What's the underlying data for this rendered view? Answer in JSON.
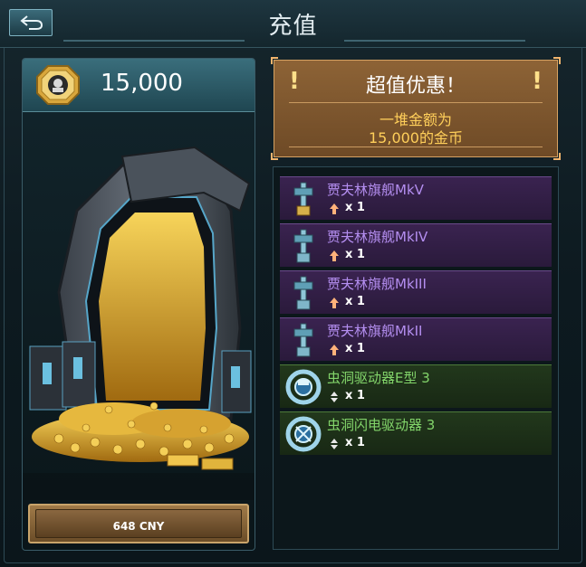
{
  "header": {
    "title": "充值",
    "back_icon": "back-arrow-icon"
  },
  "pack": {
    "coin_icon": "gold-coin-icon",
    "coin_amount": "15,000",
    "image": "gold-vault-illustration",
    "price_label": "648 CNY"
  },
  "offer": {
    "title": "超值优惠！",
    "line1": "一堆金额为",
    "line2": "15,000的金币",
    "exclaim": "!"
  },
  "items": [
    {
      "name": "贾夫林旗舰MkV",
      "qty": "x 1",
      "rarity": "purple",
      "icon": "flagship-ship-icon",
      "class_icon": "arrow-up-icon"
    },
    {
      "name": "贾夫林旗舰MkIV",
      "qty": "x 1",
      "rarity": "purple",
      "icon": "flagship-ship-icon",
      "class_icon": "arrow-up-icon"
    },
    {
      "name": "贾夫林旗舰MkIII",
      "qty": "x 1",
      "rarity": "purple",
      "icon": "flagship-ship-icon",
      "class_icon": "arrow-up-icon"
    },
    {
      "name": "贾夫林旗舰MkII",
      "qty": "x 1",
      "rarity": "purple",
      "icon": "flagship-ship-icon",
      "class_icon": "arrow-up-icon"
    },
    {
      "name": "虫洞驱动器E型 3",
      "qty": "x 1",
      "rarity": "green",
      "icon": "wormhole-drive-icon",
      "class_icon": "diamond-icon"
    },
    {
      "name": "虫洞闪电驱动器 3",
      "qty": "x 1",
      "rarity": "green",
      "icon": "wormhole-drive-icon",
      "class_icon": "diamond-icon"
    }
  ],
  "colors": {
    "purple_text": "#b48ef0",
    "green_text": "#82d46a",
    "gold_text": "#ffcf5a",
    "offer_bg": "#8d6336"
  }
}
